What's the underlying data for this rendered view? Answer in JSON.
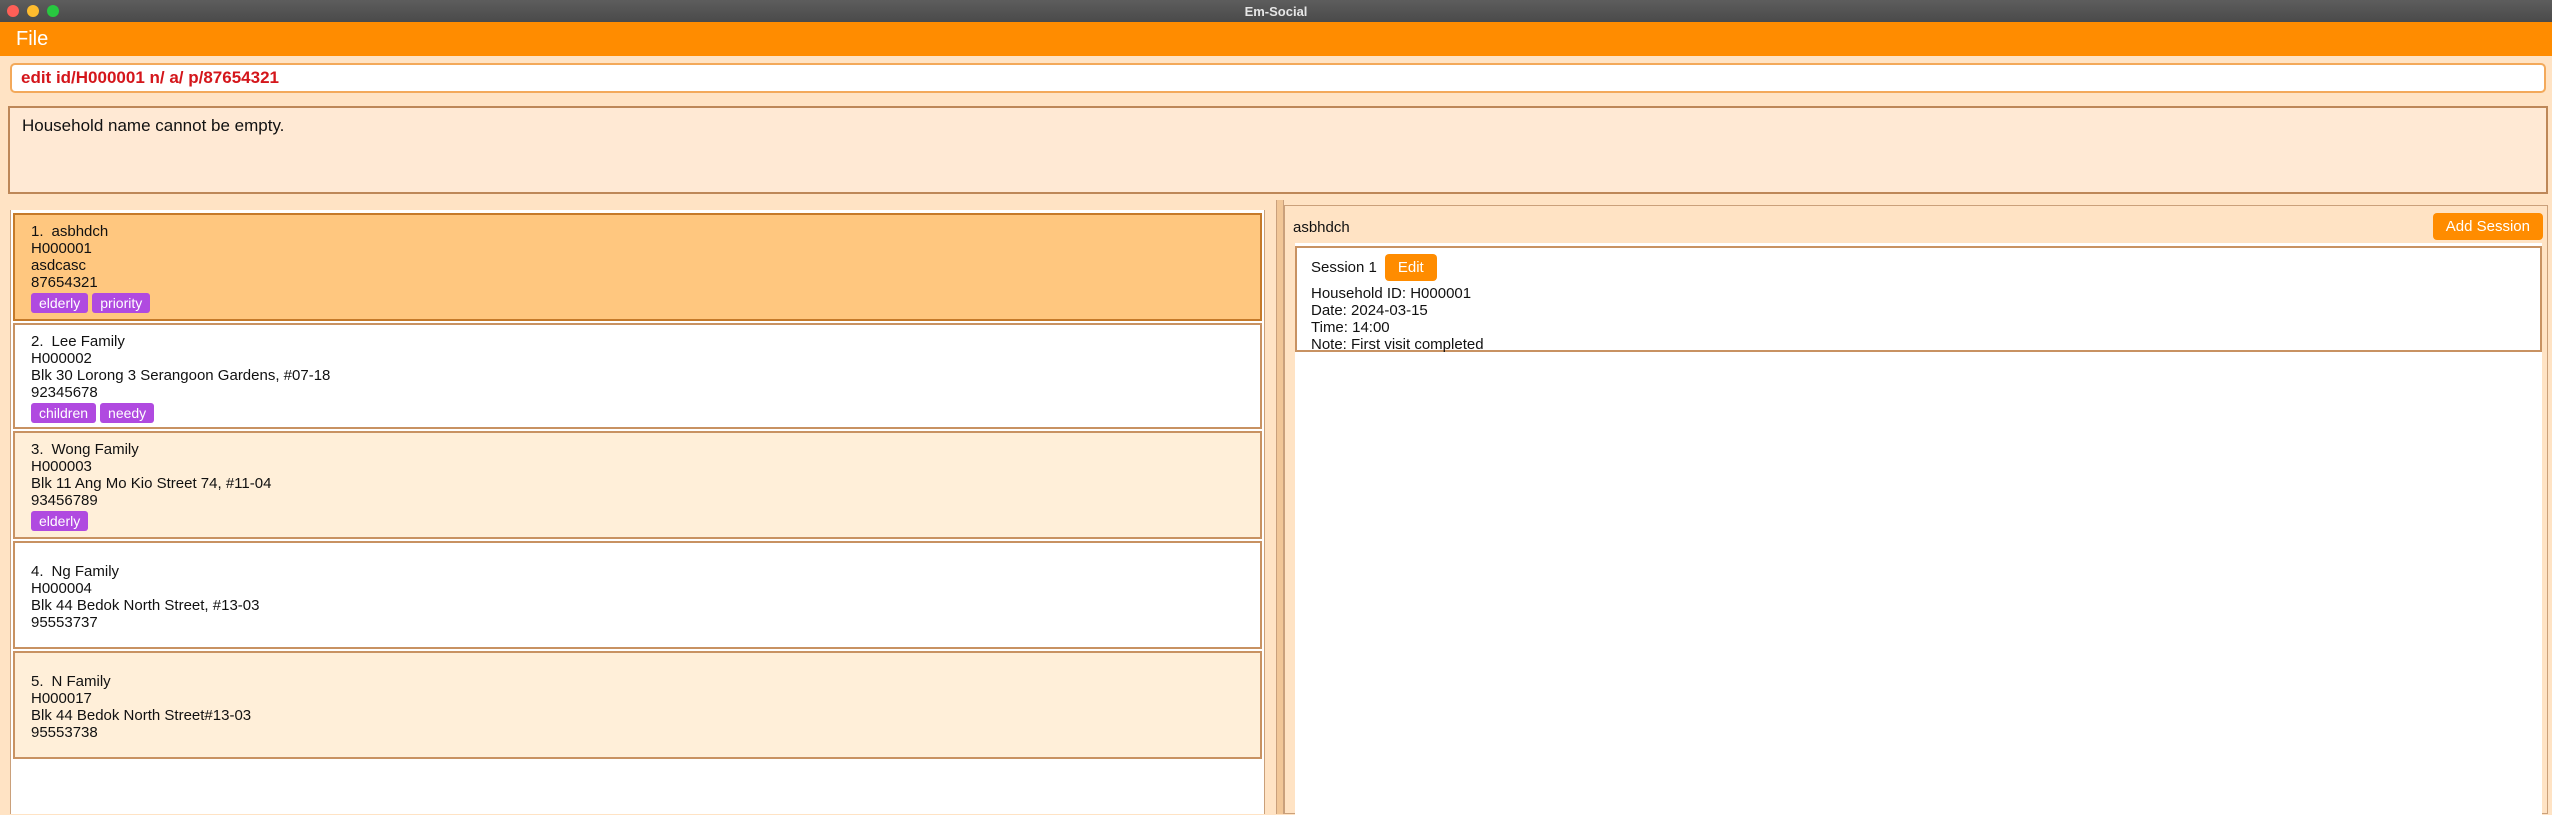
{
  "window": {
    "title": "Em-Social"
  },
  "menu": {
    "file_label": "File"
  },
  "command": {
    "value": "edit id/H000001 n/ a/ p/87654321"
  },
  "result": {
    "message": "Household name cannot be empty."
  },
  "households": [
    {
      "index": "1.",
      "name": "asbhdch",
      "id": "H000001",
      "address": "asdcasc",
      "phone": "87654321",
      "tags": [
        "elderly",
        "priority"
      ]
    },
    {
      "index": "2.",
      "name": "Lee Family",
      "id": "H000002",
      "address": "Blk 30 Lorong 3 Serangoon Gardens, #07-18",
      "phone": "92345678",
      "tags": [
        "children",
        "needy"
      ]
    },
    {
      "index": "3.",
      "name": "Wong Family",
      "id": "H000003",
      "address": "Blk 11 Ang Mo Kio Street 74, #11-04",
      "phone": "93456789",
      "tags": [
        "elderly"
      ]
    },
    {
      "index": "4.",
      "name": "Ng Family",
      "id": "H000004",
      "address": "Blk 44 Bedok North Street, #13-03",
      "phone": "95553737",
      "tags": []
    },
    {
      "index": "5.",
      "name": "N Family",
      "id": "H000017",
      "address": "Blk 44 Bedok North Street#13-03",
      "phone": "95553738",
      "tags": []
    }
  ],
  "session_panel": {
    "household_name": "asbhdch",
    "add_session_label": "Add Session",
    "sessions": [
      {
        "title": "Session 1",
        "edit_label": "Edit",
        "household_id": "Household ID: H000001",
        "date": "Date: 2024-03-15",
        "time": "Time: 14:00",
        "note": "Note: First visit completed"
      }
    ]
  },
  "colors": {
    "accent": "#ff8c00",
    "tag": "#b04ae0",
    "error_text": "#d4161b",
    "selected_card": "#ffc77f"
  }
}
